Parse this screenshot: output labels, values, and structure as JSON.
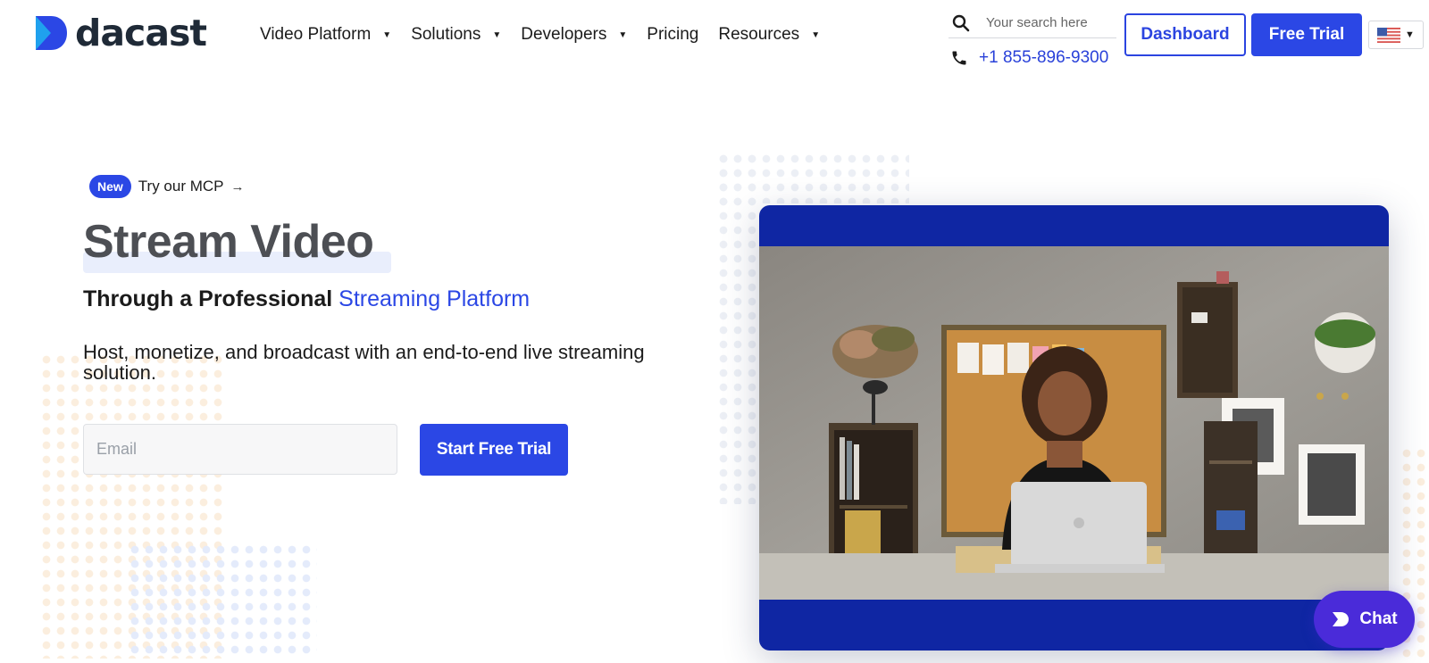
{
  "brand": {
    "name": "dacast",
    "accent": "#2b47e5",
    "dark_blue": "#0f26a3",
    "chat_purple": "#4a2bd9"
  },
  "nav": {
    "items": [
      {
        "label": "Video Platform",
        "has_dropdown": true
      },
      {
        "label": "Solutions",
        "has_dropdown": true
      },
      {
        "label": "Developers",
        "has_dropdown": true
      },
      {
        "label": "Pricing",
        "has_dropdown": false
      },
      {
        "label": "Resources",
        "has_dropdown": true
      }
    ]
  },
  "header": {
    "search_placeholder": "Your search here",
    "phone": "+1 855-896-9300",
    "dashboard_label": "Dashboard",
    "free_trial_label": "Free Trial",
    "language_icon": "us-flag-icon"
  },
  "hero": {
    "badge": "New",
    "announcement": "Try our MCP",
    "title": "Stream Video",
    "subtitle_prefix": "Through a Professional ",
    "subtitle_accent": "Streaming Platform",
    "description": "Host, monetize, and broadcast with an end-to-end live streaming solution.",
    "email_placeholder": "Email",
    "cta_label": "Start Free Trial"
  },
  "chat": {
    "label": "Chat"
  }
}
